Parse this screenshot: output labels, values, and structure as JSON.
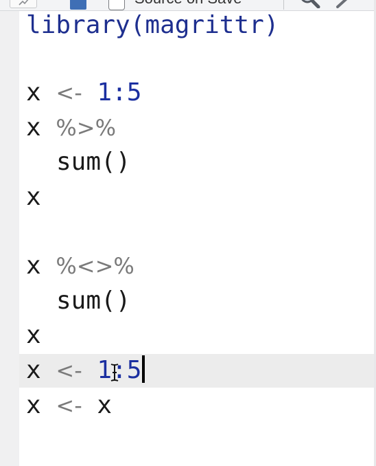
{
  "toolbar": {
    "source_on_save_label": "Source on Save",
    "source_on_save_checked": false,
    "icons": [
      "page-preview-icon",
      "save-icon",
      "search-icon",
      "magic-wand-icon"
    ]
  },
  "editor": {
    "lines": {
      "l0": "library(magrittr)",
      "l1": "",
      "l2_var": "x",
      "l2_op": "<-",
      "l2_val": "1:5",
      "l3_var": "x",
      "l3_op": "%>%",
      "l4_fn": "sum()",
      "l5_var": "x",
      "l6": "",
      "l7_var": "x",
      "l7_op": "%<>%",
      "l8_fn": "sum()",
      "l9_var": "x",
      "l10_var": "x",
      "l10_op": "<-",
      "l10_val": "1:5",
      "l11_var": "x",
      "l11_op": "<-",
      "l11_val": "x"
    },
    "active_line": 10
  },
  "colors": {
    "function_name": "#1e2f8f",
    "number": "#1b2fa0",
    "operator": "#7a7a7a",
    "text": "#1a1a1a",
    "active_line_bg": "#ececec",
    "gutter_bg": "#f0f0f1"
  }
}
